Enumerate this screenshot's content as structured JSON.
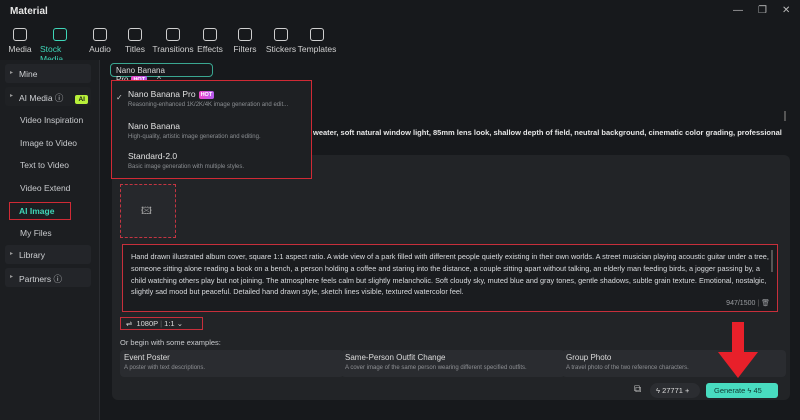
{
  "window": {
    "title": "Material"
  },
  "toolbar": [
    {
      "label": "Media"
    },
    {
      "label": "Stock Media"
    },
    {
      "label": "Audio"
    },
    {
      "label": "Titles"
    },
    {
      "label": "Transitions"
    },
    {
      "label": "Effects"
    },
    {
      "label": "Filters"
    },
    {
      "label": "Stickers"
    },
    {
      "label": "Templates"
    }
  ],
  "sidebar": {
    "mine": "Mine",
    "ai_media": "AI Media",
    "ai_badge": "AI",
    "items": [
      "Video Inspiration",
      "Image to Video",
      "Text to Video",
      "Video Extend",
      "AI Image",
      "My Files"
    ],
    "library": "Library",
    "partners": "Partners"
  },
  "model": {
    "selected": "Nano Banana Pro",
    "hot": "HOT",
    "options": [
      {
        "name": "Nano Banana Pro",
        "desc": "Reasoning-enhanced 1K/2K/4K image generation and edit...",
        "hot": "HOT"
      },
      {
        "name": "Nano Banana",
        "desc": "High-quality, artistic image generation and editing."
      },
      {
        "name": "Standard-2.0",
        "desc": "Basic image generation with multiple styles."
      }
    ]
  },
  "previous_prompt": "weater, soft natural window light, 85mm lens look, shallow depth of field, neutral background, cinematic color grading, professional",
  "prompt": {
    "text": "Hand drawn illustrated album cover, square 1:1 aspect ratio. A wide view of a park filled with different people quietly existing in their own worlds. A street musician playing acoustic guitar under a tree, someone sitting alone reading a book on a bench, a person holding a coffee and staring into the distance, a couple sitting apart without talking, an elderly man feeding birds, a jogger passing by, a child watching others play but not joining. The atmosphere feels calm but slightly melancholic. Soft cloudy sky, muted blue and gray tones, gentle shadows, subtle grain texture. Emotional, nostalgic, slightly sad mood but peaceful. Detailed hand drawn style, sketch lines visible, textured watercolor feel.",
    "counter": "947/1500"
  },
  "settings": {
    "resolution": "1080P",
    "ratio": "1:1"
  },
  "examples": {
    "label": "Or begin with some examples:",
    "items": [
      {
        "title": "Event Poster",
        "desc": "A poster with text descriptions."
      },
      {
        "title": "Same-Person Outfit Change",
        "desc": "A cover image of the same person wearing different specified outfits."
      },
      {
        "title": "Group Photo",
        "desc": "A travel photo of the two reference characters."
      }
    ]
  },
  "footer": {
    "credits": "27771",
    "generate": "Generate",
    "cost": "45"
  },
  "colors": {
    "accent": "#48dcc0",
    "highlight": "#d02a35"
  }
}
